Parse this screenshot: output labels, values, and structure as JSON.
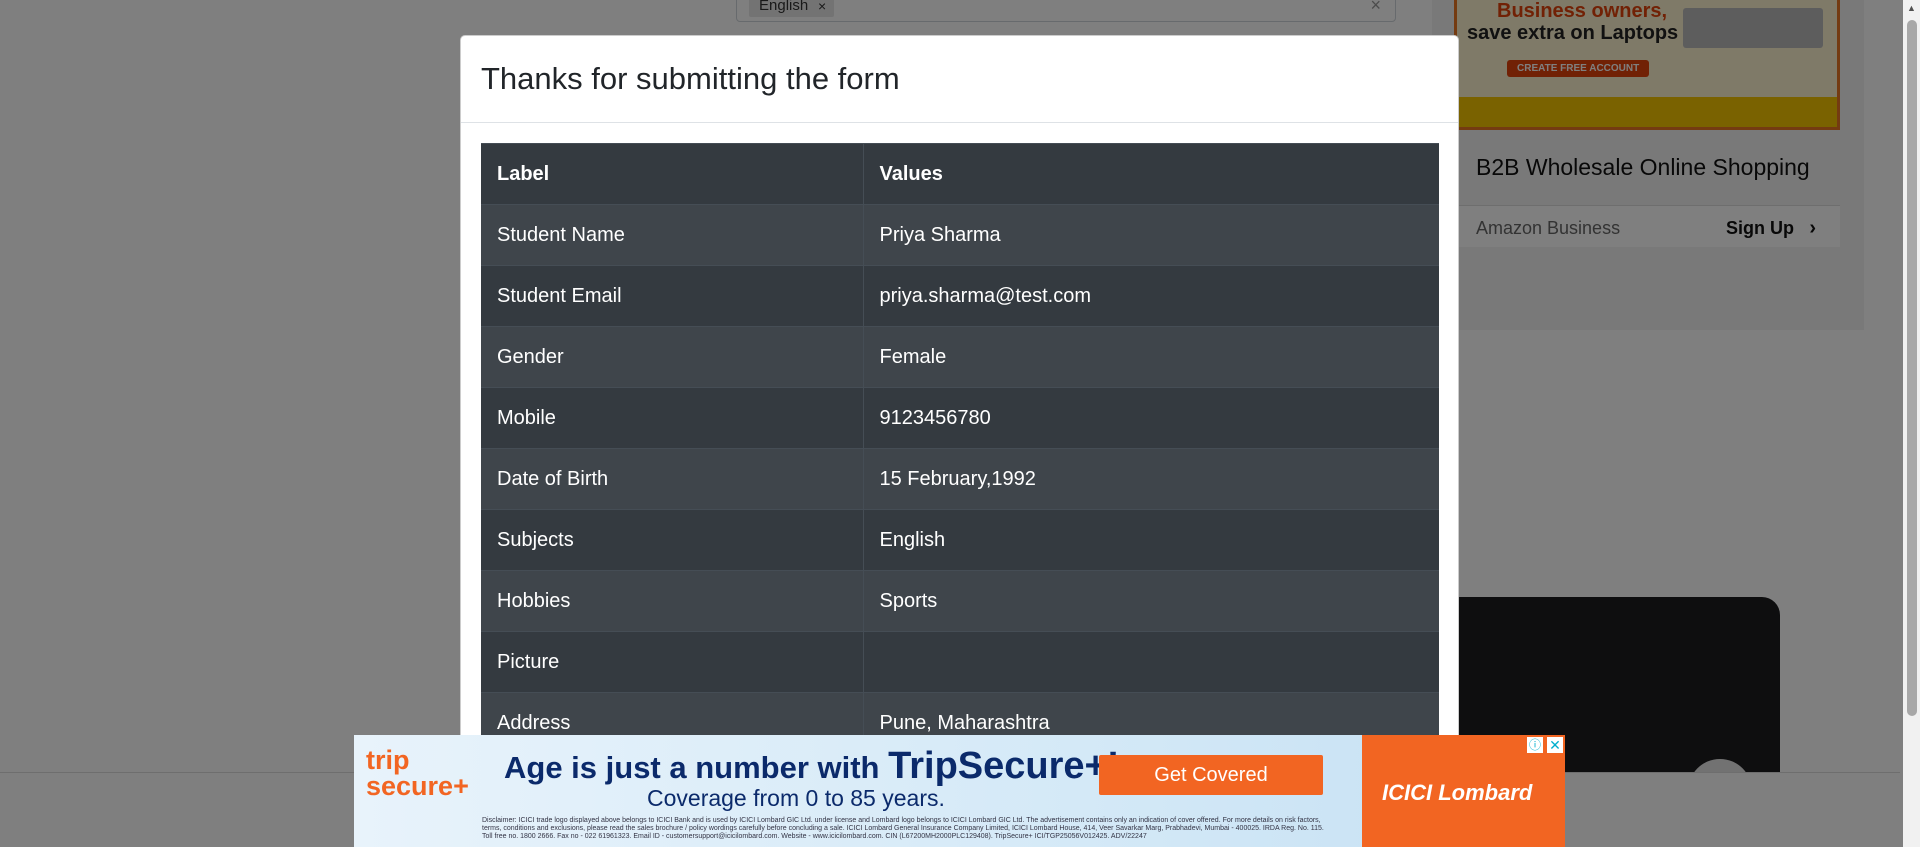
{
  "background": {
    "subjects_chip": "English",
    "ad": {
      "banner_line1": "Business owners,",
      "banner_line2": "save extra on Laptops",
      "banner_button": "CREATE FREE ACCOUNT",
      "title": "B2B Wholesale Online Shopping",
      "brand": "Amazon Business",
      "signup": "Sign Up"
    }
  },
  "modal": {
    "title": "Thanks for submitting the form",
    "table": {
      "headers": [
        "Label",
        "Values"
      ],
      "rows": [
        {
          "label": "Student Name",
          "value": "Priya Sharma"
        },
        {
          "label": "Student Email",
          "value": "priya.sharma@test.com"
        },
        {
          "label": "Gender",
          "value": "Female"
        },
        {
          "label": "Mobile",
          "value": "9123456780"
        },
        {
          "label": "Date of Birth",
          "value": "15 February,1992"
        },
        {
          "label": "Subjects",
          "value": "English"
        },
        {
          "label": "Hobbies",
          "value": "Sports"
        },
        {
          "label": "Picture",
          "value": ""
        },
        {
          "label": "Address",
          "value": "Pune, Maharashtra"
        }
      ]
    }
  },
  "bottom_ad": {
    "logo_line1": "trip",
    "logo_line2": "secure+",
    "headline_prefix": "Age is just a number with ",
    "headline_brand": "TripSecure+!",
    "subline": "Coverage from 0 to 85 years.",
    "cta": "Get Covered",
    "brand": "ICICI Lombard",
    "disclaimer": "Disclaimer: ICICI trade logo displayed above belongs to ICICI Bank and is used by ICICI Lombard GIC Ltd. under license and Lombard logo belongs to ICICI Lombard GIC Ltd. The advertisement contains only an indication of cover offered. For more details on risk factors, terms, conditions and exclusions, please read the sales brochure / policy wordings carefully before concluding a sale. ICICI Lombard General Insurance Company Limited, ICICI Lombard House, 414, Veer Savarkar Marg, Prabhadevi, Mumbai - 400025. IRDA Reg. No. 115. Toll free no. 1800 2666. Fax no - 022 61961323. Email ID - customersupport@icicilombard.com. Website - www.icicilombard.com. CIN (L67200MH2000PLC129408). TripSecure+ ICI/TGP25056V012425. ADV/22247"
  }
}
